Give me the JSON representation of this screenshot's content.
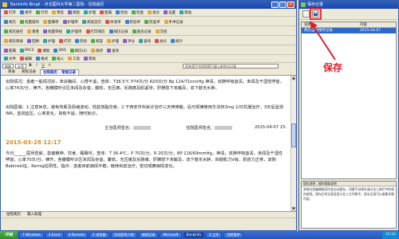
{
  "main_window": {
    "title": "BankInfo Bingli - 河北医科大学第二医院 - 住院病历",
    "buttons": {
      "minimize": "_",
      "maximize": "□",
      "close": "×"
    }
  },
  "toolbar_rows": [
    [
      "打开",
      "保存",
      "打印",
      "预览",
      "病程",
      "护理",
      "医嘱",
      "检验",
      "检查",
      "会诊",
      "设置",
      "帮助"
    ],
    [
      "病历",
      "批量操作",
      "医嘱单",
      "护理单",
      "病案首页",
      "体温单",
      "检验单",
      "检查单",
      "手术记录"
    ],
    [
      "病历质控",
      "患者",
      "批量审核",
      "护理单",
      "打印病历",
      "病历记录",
      "查房记录",
      "交班"
    ],
    [
      "病历目录",
      "回顾",
      "护理",
      "打印",
      "检验",
      "病案",
      "护理",
      "评分",
      "查询",
      "会诊",
      "统计"
    ],
    [
      "医嘱",
      "PACS",
      "模板",
      "DAS",
      "病历(2)",
      "质控",
      "查询"
    ],
    [
      "文件",
      "编辑",
      "格式",
      "插入",
      "工具",
      "帮助"
    ]
  ],
  "format_bar": {
    "font_select": "宋体",
    "size_select": "五号",
    "buttons": [
      "B",
      "I",
      "U",
      "A"
    ],
    "notice": "此处用于书写科室已录入的会诊记录"
  },
  "doc_tabs": [
    "目录",
    "病程记录",
    "住院病历 - 常规记录"
  ],
  "document": {
    "p1": "出院情况：患者一般情况好，未诉胸闷、心悸不适，查体：T36.5℃ P74次/分 R20次/分 Bp 124/71mmHg 神清，双肺呼吸音清，未闻及干湿性啰音，心率74次/分，律齐，各瓣膜听诊区未闻及杂音，腹软，无压痛，反跳痛及肌紧张，肝脾肋下未触及，双下肢无水肿。",
    "p2": "出院医嘱：1.注意休息，避免劳累及情绪波动，低盐低脂饮食。2.于西安市科就诊治疗三天伸抻脑，后可规律使用华法林3mg 1/日抗凝治疗，3天后监测INR，监测血压。心率变化，如有不适，随时就诊。",
    "sign1": "主治医师签名：",
    "sign2": "住院医师签名：",
    "sign_date": "2015-04-07 15:",
    "date_heading": "2015-03-28 12:17",
    "p3": "今日______医师查房，患者精神、饮食、睡眠可，查体：T 36.4℃，P 70次/分，R 20次/分，BP 116/69mmHg，神清，双肺呼吸音清，未闻及干湿性啰音，心率70次/分，律齐，各瓣膜听诊区未闻及杂音。腹软，无压痛及反跳痛，肝脾肋下未触及，双下肢无水肿，四肢肌力V级，肌张力正常，双侧Babinski征、Kernig征阴性。指示：患者目前病情平稳，继续目前治疗。密切观察病情变化。"
  },
  "bottom_tabs": [
    "住院病历",
    "输入助理"
  ],
  "status_text": "",
  "side_window": {
    "title": "保存记录",
    "list_headers": [
      "说明",
      "内容"
    ],
    "list_row": [
      "病历自动保存记录",
      "2015-04-07"
    ],
    "bottom_title": "保存说明 - 操作帮助说明",
    "bottom_text": "系统在您编辑病历时会自动保存，如需手动保存请点击工具栏中的保存按钮。保存后的记录会显示在上方列表中，双击记录可以查看详细内容。"
  },
  "annotation": {
    "label": "保存"
  },
  "taskbar": {
    "start": "开始",
    "items": [
      "7 Windows",
      "3 Excel",
      "4 Remote",
      "2 浏览器",
      "河北医科二院",
      "病程记录",
      "Microsoft",
      "BankInfo",
      "2 工作",
      "住院医护"
    ],
    "clock": "15:22"
  },
  "colors": {
    "titlebar": "#1a45a8",
    "annotation": "#d8202c",
    "date_heading": "#d88a1c",
    "selection": "#316ac5"
  }
}
